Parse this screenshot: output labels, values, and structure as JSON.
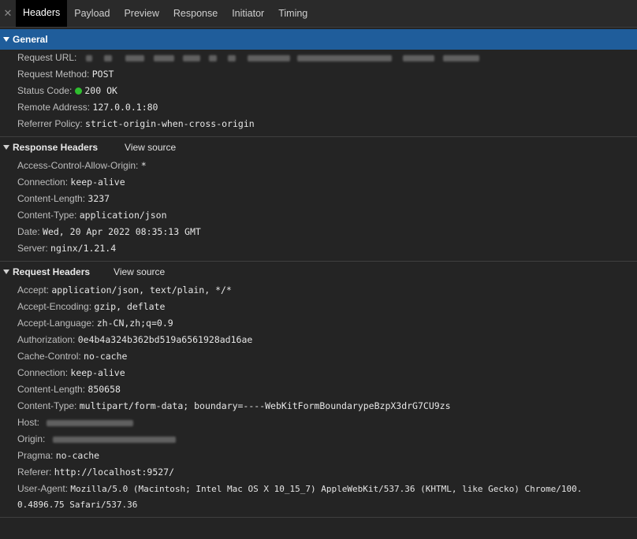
{
  "tabs": [
    {
      "label": "Headers",
      "active": true
    },
    {
      "label": "Payload",
      "active": false
    },
    {
      "label": "Preview",
      "active": false
    },
    {
      "label": "Response",
      "active": false
    },
    {
      "label": "Initiator",
      "active": false
    },
    {
      "label": "Timing",
      "active": false
    }
  ],
  "general": {
    "title": "General",
    "rows": [
      {
        "key": "Request URL:",
        "value": ""
      },
      {
        "key": "Request Method:",
        "value": "POST"
      },
      {
        "key": "Status Code:",
        "value": "200 OK"
      },
      {
        "key": "Remote Address:",
        "value": "127.0.0.1:80"
      },
      {
        "key": "Referrer Policy:",
        "value": "strict-origin-when-cross-origin"
      }
    ]
  },
  "response_headers": {
    "title": "Response Headers",
    "view_source": "View source",
    "rows": [
      {
        "key": "Access-Control-Allow-Origin:",
        "value": "*"
      },
      {
        "key": "Connection:",
        "value": "keep-alive"
      },
      {
        "key": "Content-Length:",
        "value": "3237"
      },
      {
        "key": "Content-Type:",
        "value": "application/json"
      },
      {
        "key": "Date:",
        "value": "Wed, 20 Apr 2022 08:35:13 GMT"
      },
      {
        "key": "Server:",
        "value": "nginx/1.21.4"
      }
    ]
  },
  "request_headers": {
    "title": "Request Headers",
    "view_source": "View source",
    "rows": [
      {
        "key": "Accept:",
        "value": "application/json, text/plain, */*"
      },
      {
        "key": "Accept-Encoding:",
        "value": "gzip, deflate"
      },
      {
        "key": "Accept-Language:",
        "value": "zh-CN,zh;q=0.9"
      },
      {
        "key": "Authorization:",
        "value": "0e4b4a324b362bd519a6561928ad16ae"
      },
      {
        "key": "Cache-Control:",
        "value": "no-cache"
      },
      {
        "key": "Connection:",
        "value": "keep-alive"
      },
      {
        "key": "Content-Length:",
        "value": "850658"
      },
      {
        "key": "Content-Type:",
        "value": "multipart/form-data; boundary=----WebKitFormBoundarypeBzpX3drG7CU9zs"
      },
      {
        "key": "Host:",
        "value": ""
      },
      {
        "key": "Origin:",
        "value": ""
      },
      {
        "key": "Pragma:",
        "value": "no-cache"
      },
      {
        "key": "Referer:",
        "value": "http://localhost:9527/"
      },
      {
        "key": "User-Agent:",
        "value": "Mozilla/5.0 (Macintosh; Intel Mac OS X 10_15_7) AppleWebKit/537.36 (KHTML, like Gecko) Chrome/100.",
        "continuation": "0.4896.75 Safari/537.36"
      }
    ]
  },
  "colors": {
    "status_ok": "#2fbe2f",
    "selected_header": "#1f5d9b"
  }
}
